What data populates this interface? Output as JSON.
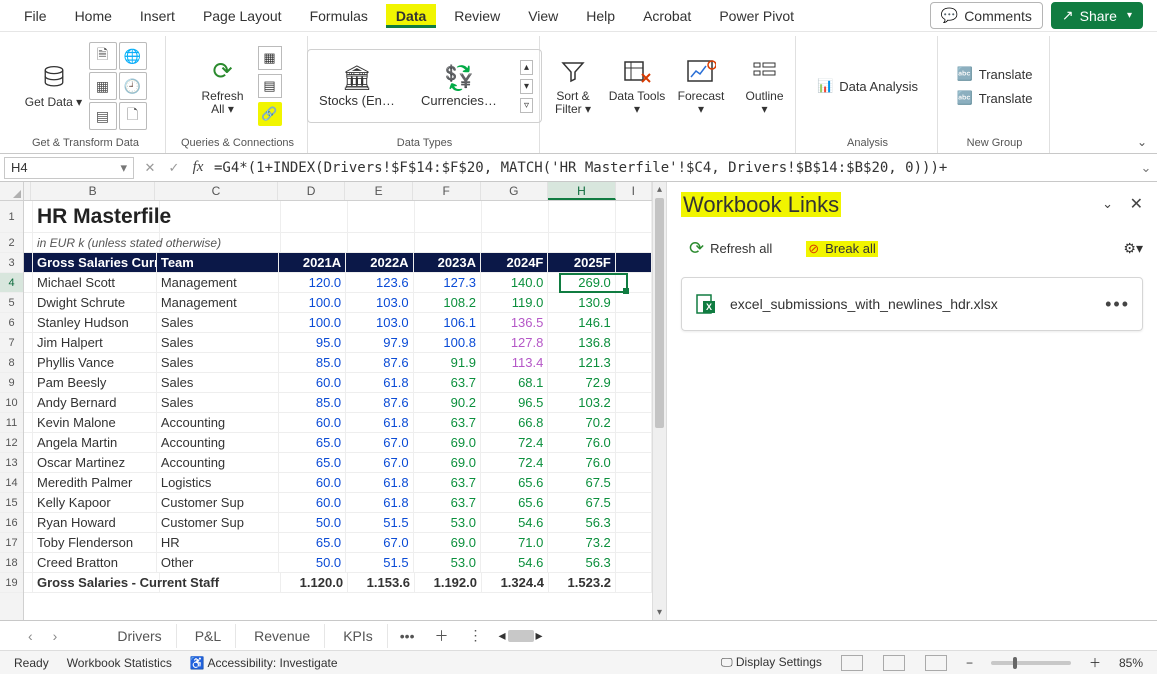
{
  "menu": {
    "tabs": [
      "File",
      "Home",
      "Insert",
      "Page Layout",
      "Formulas",
      "Data",
      "Review",
      "View",
      "Help",
      "Acrobat",
      "Power Pivot"
    ],
    "active": "Data",
    "comments": "Comments",
    "share": "Share"
  },
  "ribbon": {
    "getdata": "Get Data",
    "gt_label": "Get & Transform Data",
    "refreshall": "Refresh All",
    "qc_label": "Queries & Connections",
    "stocks": "Stocks (En…",
    "currencies": "Currencies…",
    "dt_label": "Data Types",
    "sortfilter": "Sort & Filter",
    "datatools": "Data Tools",
    "forecast": "Forecast",
    "outline": "Outline",
    "dataanalysis": "Data Analysis",
    "analysis_label": "Analysis",
    "translate": "Translate",
    "newgroup_label": "New Group"
  },
  "formulaBar": {
    "cellRef": "H4",
    "formula": "=G4*(1+INDEX(Drivers!$F$14:$F$20, MATCH('HR Masterfile'!$C4, Drivers!$B$14:$B$20, 0)))+"
  },
  "sheet": {
    "title": "HR Masterfile",
    "subtitle": "in EUR k (unless stated otherwise)",
    "columns": {
      "b": "Gross Salaries Curr",
      "c": "Team",
      "d": "2021A",
      "e": "2022A",
      "f": "2023A",
      "g": "2024F",
      "h": "2025F"
    },
    "rows": [
      {
        "n": 4,
        "b": "Michael Scott",
        "c": "Management",
        "d": "120.0",
        "e": "123.6",
        "f": "127.3",
        "g": "140.0",
        "h": "269.0",
        "gcls": "num-green"
      },
      {
        "n": 5,
        "b": "Dwight Schrute",
        "c": "Management",
        "d": "100.0",
        "e": "103.0",
        "f": "108.2",
        "g": "119.0",
        "h": "130.9",
        "fcls": "num-green",
        "gcls": "num-green"
      },
      {
        "n": 6,
        "b": "Stanley Hudson",
        "c": "Sales",
        "d": "100.0",
        "e": "103.0",
        "f": "106.1",
        "g": "136.5",
        "h": "146.1",
        "gcls": "num-purple"
      },
      {
        "n": 7,
        "b": "Jim Halpert",
        "c": "Sales",
        "d": "95.0",
        "e": "97.9",
        "f": "100.8",
        "g": "127.8",
        "h": "136.8",
        "gcls": "num-purple"
      },
      {
        "n": 8,
        "b": "Phyllis Vance",
        "c": "Sales",
        "d": "85.0",
        "e": "87.6",
        "f": "91.9",
        "g": "113.4",
        "h": "121.3",
        "fcls": "num-green",
        "gcls": "num-purple"
      },
      {
        "n": 9,
        "b": "Pam Beesly",
        "c": "Sales",
        "d": "60.0",
        "e": "61.8",
        "f": "63.7",
        "g": "68.1",
        "h": "72.9",
        "fcls": "num-green",
        "gcls": "num-green"
      },
      {
        "n": 10,
        "b": "Andy Bernard",
        "c": "Sales",
        "d": "85.0",
        "e": "87.6",
        "f": "90.2",
        "g": "96.5",
        "h": "103.2",
        "fcls": "num-green",
        "gcls": "num-green"
      },
      {
        "n": 11,
        "b": "Kevin Malone",
        "c": "Accounting",
        "d": "60.0",
        "e": "61.8",
        "f": "63.7",
        "g": "66.8",
        "h": "70.2",
        "fcls": "num-green",
        "gcls": "num-green"
      },
      {
        "n": 12,
        "b": "Angela Martin",
        "c": "Accounting",
        "d": "65.0",
        "e": "67.0",
        "f": "69.0",
        "g": "72.4",
        "h": "76.0",
        "fcls": "num-green",
        "gcls": "num-green"
      },
      {
        "n": 13,
        "b": "Oscar Martinez",
        "c": "Accounting",
        "d": "65.0",
        "e": "67.0",
        "f": "69.0",
        "g": "72.4",
        "h": "76.0",
        "fcls": "num-green",
        "gcls": "num-green"
      },
      {
        "n": 14,
        "b": "Meredith Palmer",
        "c": "Logistics",
        "d": "60.0",
        "e": "61.8",
        "f": "63.7",
        "g": "65.6",
        "h": "67.5",
        "fcls": "num-green",
        "gcls": "num-green"
      },
      {
        "n": 15,
        "b": "Kelly Kapoor",
        "c": "Customer Sup",
        "d": "60.0",
        "e": "61.8",
        "f": "63.7",
        "g": "65.6",
        "h": "67.5",
        "fcls": "num-green",
        "gcls": "num-green"
      },
      {
        "n": 16,
        "b": "Ryan Howard",
        "c": "Customer Sup",
        "d": "50.0",
        "e": "51.5",
        "f": "53.0",
        "g": "54.6",
        "h": "56.3",
        "fcls": "num-green",
        "gcls": "num-green"
      },
      {
        "n": 17,
        "b": "Toby Flenderson",
        "c": "HR",
        "d": "65.0",
        "e": "67.0",
        "f": "69.0",
        "g": "71.0",
        "h": "73.2",
        "fcls": "num-green",
        "gcls": "num-green"
      },
      {
        "n": 18,
        "b": "Creed Bratton",
        "c": "Other",
        "d": "50.0",
        "e": "51.5",
        "f": "53.0",
        "g": "54.6",
        "h": "56.3",
        "fcls": "num-green",
        "gcls": "num-green"
      }
    ],
    "totals": {
      "n": 19,
      "b": "Gross Salaries - Current Staff",
      "d": "1.120.0",
      "e": "1.153.6",
      "f": "1.192.0",
      "g": "1.324.4",
      "h": "1.523.2"
    },
    "tabs": [
      "Drivers",
      "P&L",
      "Revenue",
      "KPIs"
    ]
  },
  "panel": {
    "title": "Workbook Links",
    "refresh": "Refresh all",
    "break": "Break all",
    "link": "excel_submissions_with_newlines_hdr.xlsx"
  },
  "status": {
    "ready": "Ready",
    "wbstats": "Workbook Statistics",
    "acc": "Accessibility: Investigate",
    "display": "Display Settings",
    "zoom": "85%"
  }
}
